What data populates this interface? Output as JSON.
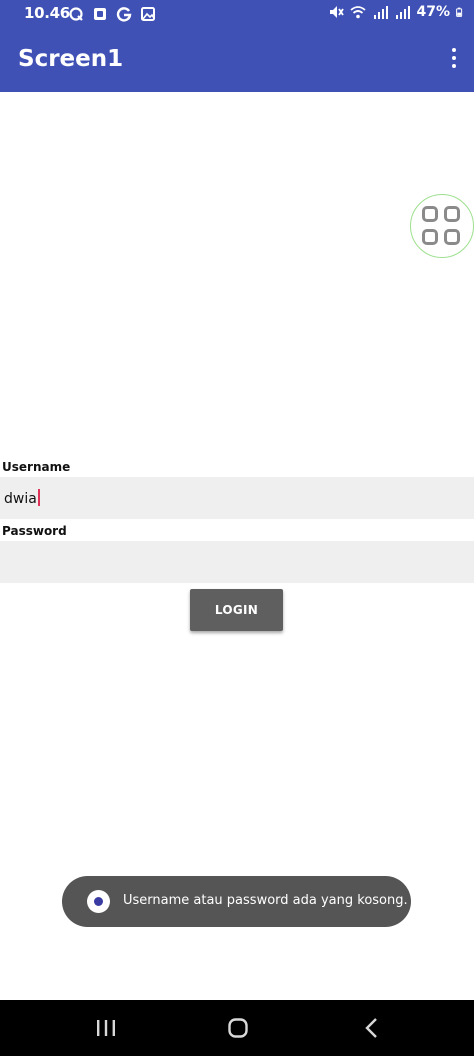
{
  "status_bar": {
    "time": "10.46",
    "battery": "47%",
    "left_icons": [
      "q-icon",
      "box-icon",
      "g-icon",
      "image-icon"
    ],
    "right_icons": [
      "mute-icon",
      "wifi-icon",
      "signal-icon",
      "signal-icon",
      "battery-icon"
    ]
  },
  "app_bar": {
    "title": "Screen1",
    "menu_icon": "more-vert-icon"
  },
  "floating_button": {
    "icon": "grid-icon"
  },
  "form": {
    "username_label": "Username",
    "username_value": "dwia",
    "password_label": "Password",
    "password_value": "",
    "login_label": "LOGIN"
  },
  "toast": {
    "message": "Username atau password ada yang kosong."
  },
  "nav_bar": {
    "icons": [
      "recents-icon",
      "home-icon",
      "back-icon"
    ]
  },
  "colors": {
    "app_bar": "#3f51b5",
    "field_background": "#efefef",
    "button_background": "#5f5f5f",
    "toast_background": "#555555",
    "caret": "#e0335a"
  }
}
